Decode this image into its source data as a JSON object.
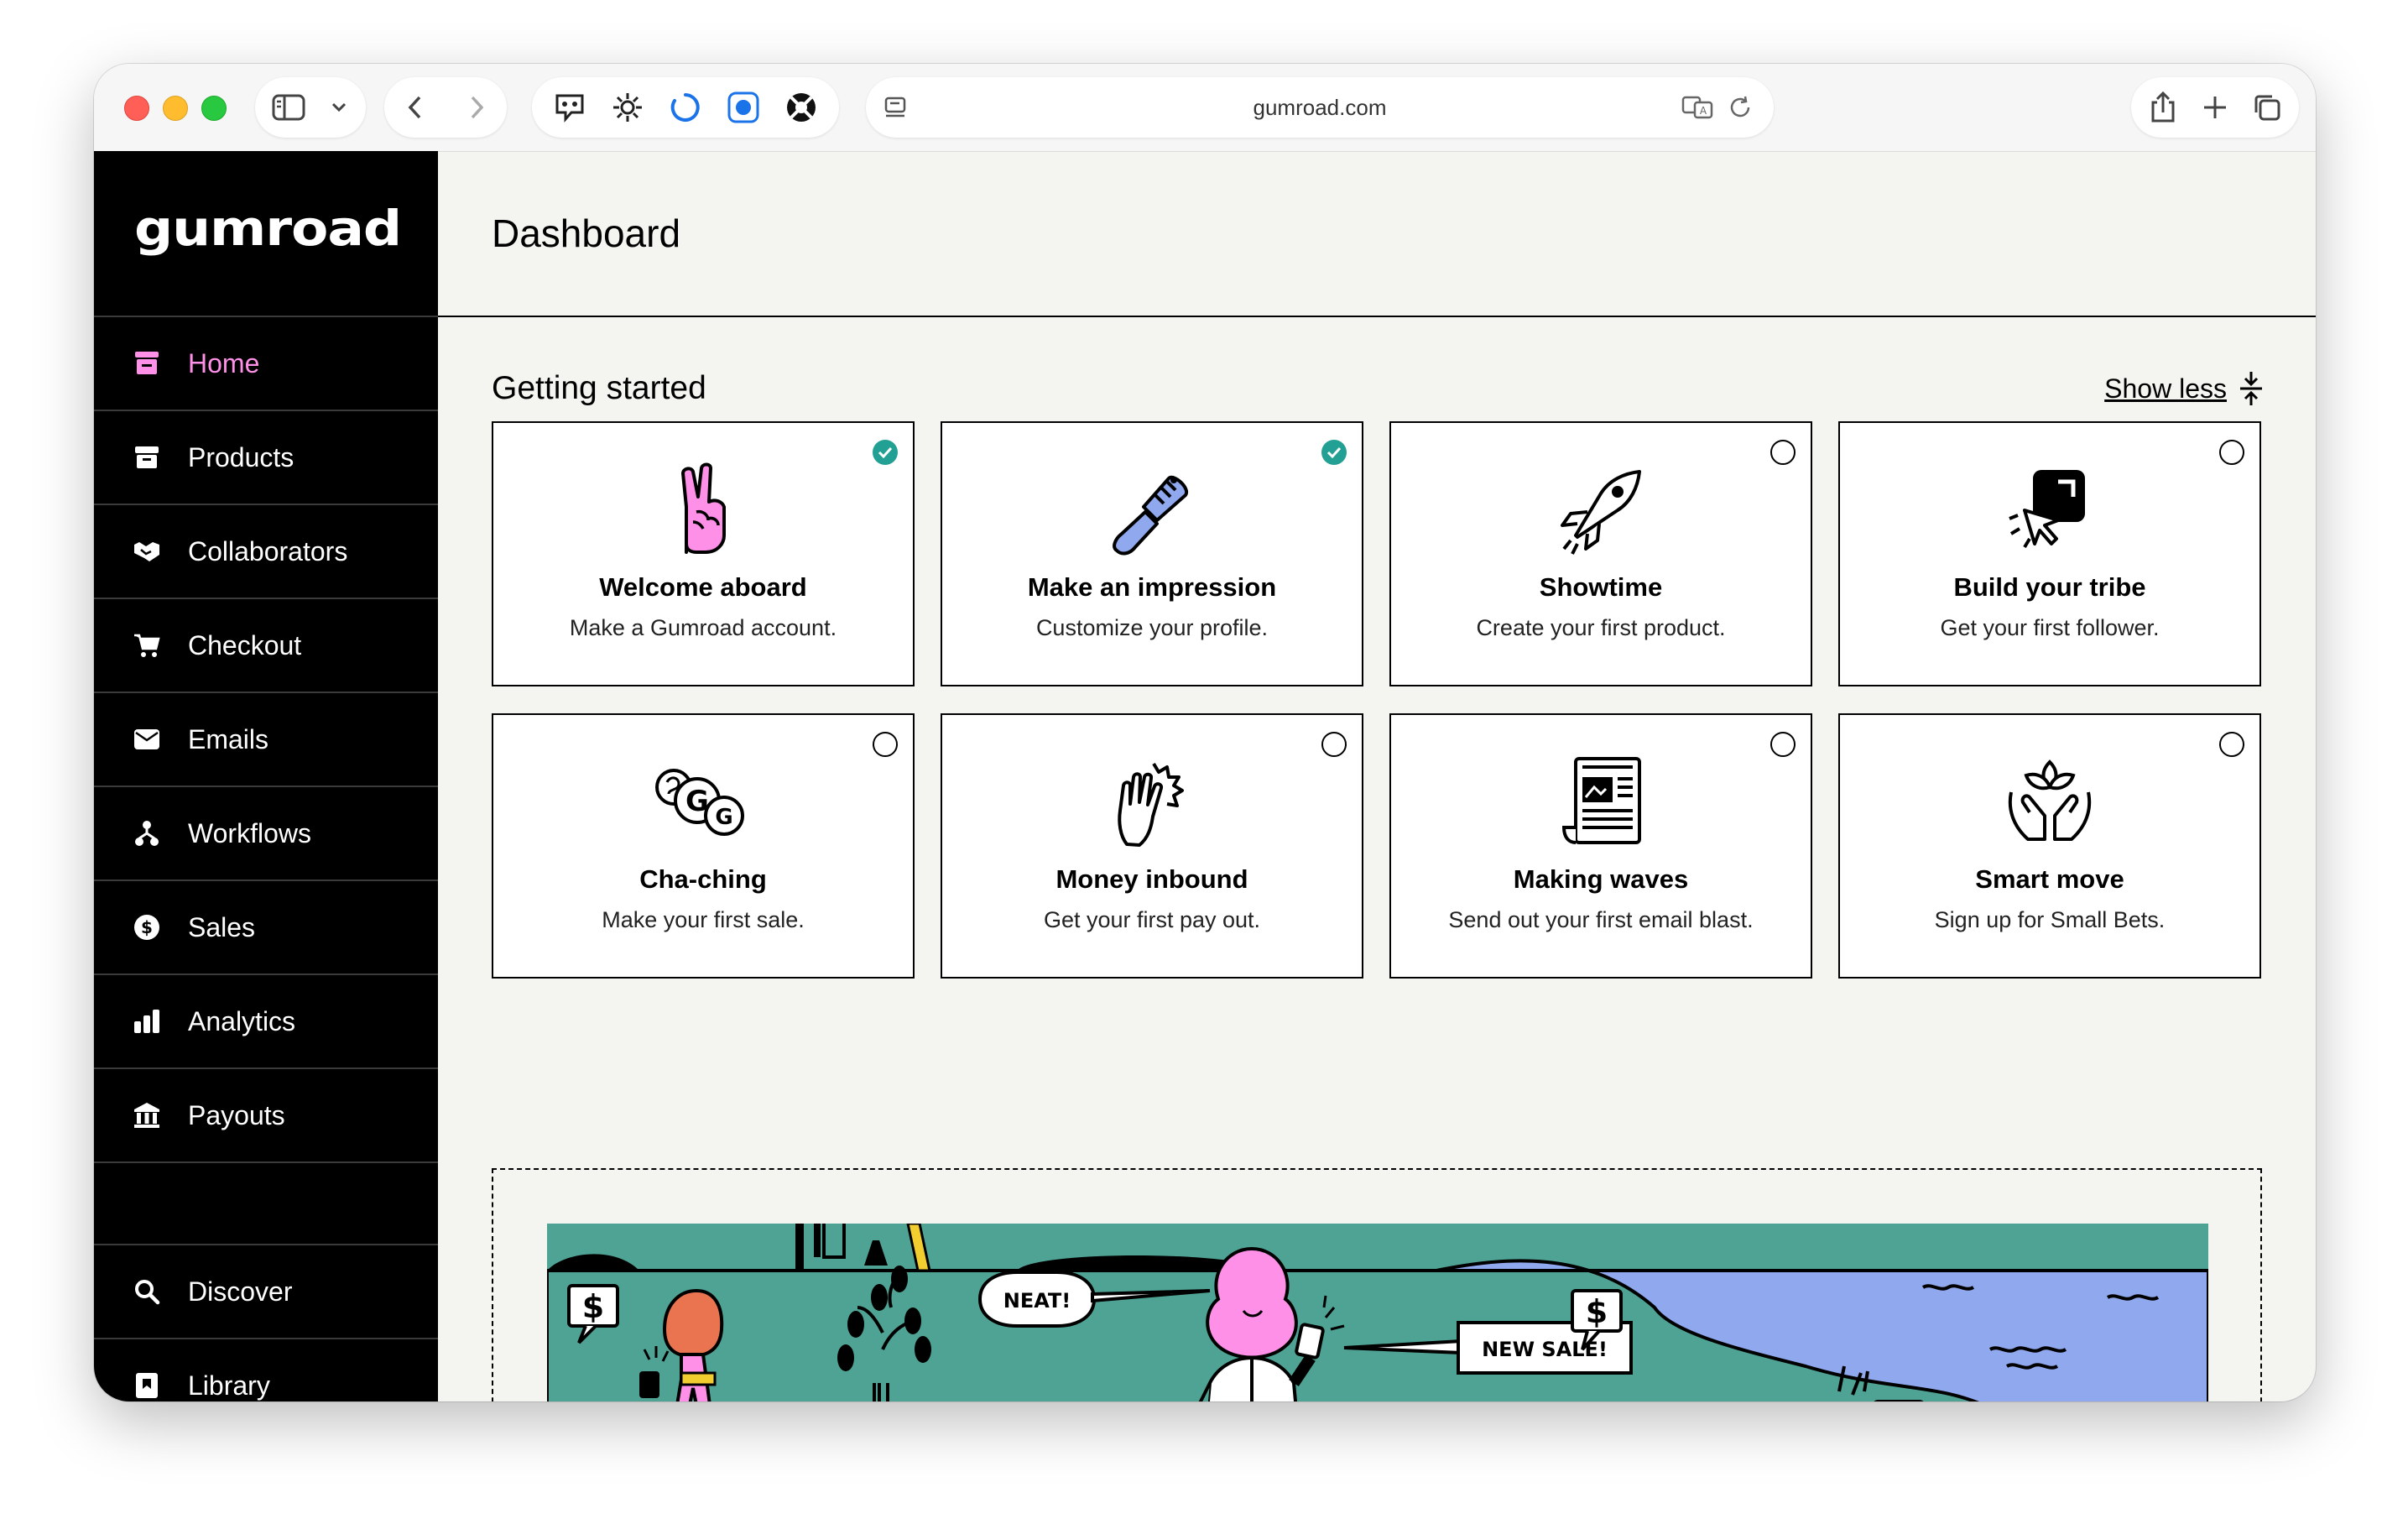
{
  "browser": {
    "url": "gumroad.com",
    "traffic_lights": [
      "#ff5f57",
      "#febc2e",
      "#28c840"
    ]
  },
  "sidebar": {
    "logo": "GUMROAD",
    "items": [
      {
        "label": "Home",
        "icon": "store-icon",
        "active": true
      },
      {
        "label": "Products",
        "icon": "archive-icon"
      },
      {
        "label": "Collaborators",
        "icon": "handshake-icon"
      },
      {
        "label": "Checkout",
        "icon": "cart-icon"
      },
      {
        "label": "Emails",
        "icon": "envelope-icon"
      },
      {
        "label": "Workflows",
        "icon": "workflow-icon"
      },
      {
        "label": "Sales",
        "icon": "dollar-circle-icon"
      },
      {
        "label": "Analytics",
        "icon": "bar-chart-icon"
      },
      {
        "label": "Payouts",
        "icon": "bank-icon"
      }
    ],
    "bottom_items": [
      {
        "label": "Discover",
        "icon": "search-icon"
      },
      {
        "label": "Library",
        "icon": "bookmark-icon"
      }
    ],
    "active_color": "#ff90e8"
  },
  "main": {
    "title": "Dashboard",
    "getting_started": {
      "title": "Getting started",
      "toggle_label": "Show less",
      "cards": [
        {
          "title": "Welcome aboard",
          "desc": "Make a Gumroad account.",
          "done": true,
          "icon": "peace-hand-icon"
        },
        {
          "title": "Make an impression",
          "desc": "Customize your profile.",
          "done": true,
          "icon": "paintbrush-icon"
        },
        {
          "title": "Showtime",
          "desc": "Create your first product.",
          "done": false,
          "icon": "rocket-icon"
        },
        {
          "title": "Build your tribe",
          "desc": "Get your first follower.",
          "done": false,
          "icon": "cursor-click-icon"
        },
        {
          "title": "Cha-ching",
          "desc": "Make your first sale.",
          "done": false,
          "icon": "coins-icon"
        },
        {
          "title": "Money inbound",
          "desc": "Get your first pay out.",
          "done": false,
          "icon": "high-five-icon"
        },
        {
          "title": "Making waves",
          "desc": "Send out your first email blast.",
          "done": false,
          "icon": "newspaper-icon"
        },
        {
          "title": "Smart move",
          "desc": "Sign up for Small Bets.",
          "done": false,
          "icon": "hands-plant-icon"
        }
      ]
    },
    "illustration": {
      "bubbles": [
        "NEAT!",
        "NEW SALE!"
      ],
      "sign": "$"
    }
  },
  "colors": {
    "accent_done": "#23a094",
    "teal": "#4fa394",
    "lavender": "#90a8ed",
    "pink": "#ff90e8"
  }
}
